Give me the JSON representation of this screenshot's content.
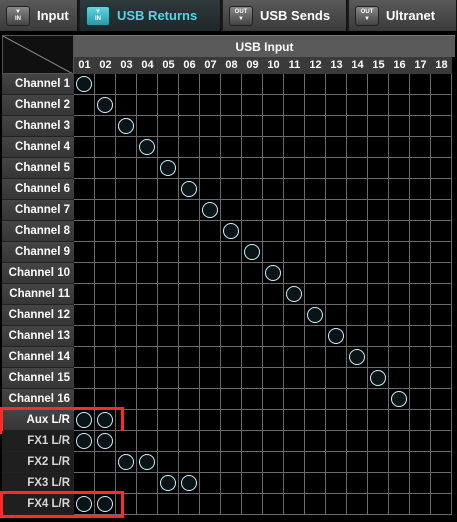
{
  "tabs": [
    {
      "label": "Input",
      "icon": "input-icon",
      "icon_text": "IN",
      "active": false
    },
    {
      "label": "USB Returns",
      "icon": "usb-returns-icon",
      "icon_text": "IN",
      "active": true
    },
    {
      "label": "USB Sends",
      "icon": "usb-sends-icon",
      "icon_text": "OUT",
      "active": false
    },
    {
      "label": "Ultranet",
      "icon": "ultranet-icon",
      "icon_text": "OUT",
      "active": false
    }
  ],
  "matrix": {
    "header": "USB Input",
    "columns": [
      "01",
      "02",
      "03",
      "04",
      "05",
      "06",
      "07",
      "08",
      "09",
      "10",
      "11",
      "12",
      "13",
      "14",
      "15",
      "16",
      "17",
      "18"
    ],
    "rows": [
      {
        "label": "Channel 1",
        "routes": [
          1
        ]
      },
      {
        "label": "Channel 2",
        "routes": [
          2
        ]
      },
      {
        "label": "Channel 3",
        "routes": [
          3
        ]
      },
      {
        "label": "Channel 4",
        "routes": [
          4
        ]
      },
      {
        "label": "Channel 5",
        "routes": [
          5
        ]
      },
      {
        "label": "Channel 6",
        "routes": [
          6
        ]
      },
      {
        "label": "Channel 7",
        "routes": [
          7
        ]
      },
      {
        "label": "Channel 8",
        "routes": [
          8
        ]
      },
      {
        "label": "Channel 9",
        "routes": [
          9
        ]
      },
      {
        "label": "Channel 10",
        "routes": [
          10
        ]
      },
      {
        "label": "Channel 11",
        "routes": [
          11
        ]
      },
      {
        "label": "Channel 12",
        "routes": [
          12
        ]
      },
      {
        "label": "Channel 13",
        "routes": [
          13
        ]
      },
      {
        "label": "Channel 14",
        "routes": [
          14
        ]
      },
      {
        "label": "Channel 15",
        "routes": [
          15
        ]
      },
      {
        "label": "Channel 16",
        "routes": [
          16
        ]
      },
      {
        "label": "Aux L/R",
        "routes": [
          1,
          2
        ],
        "highlighted": true
      },
      {
        "label": "FX1 L/R",
        "routes": [
          1,
          2
        ],
        "dark": true
      },
      {
        "label": "FX2 L/R",
        "routes": [
          3,
          4
        ],
        "dark": true
      },
      {
        "label": "FX3 L/R",
        "routes": [
          5,
          6
        ],
        "dark": true
      },
      {
        "label": "FX4 L/R",
        "routes": [
          1,
          2
        ],
        "dark": true,
        "highlighted": true
      }
    ]
  },
  "colors": {
    "accent": "#53d6e6",
    "highlight": "#ff2a2a",
    "route_dot": "#c7f3fa"
  }
}
